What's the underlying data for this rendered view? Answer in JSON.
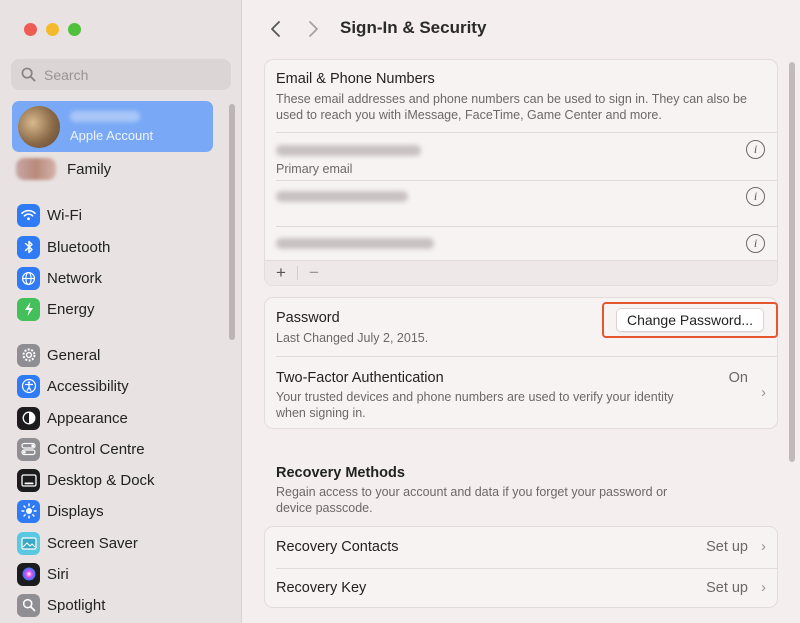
{
  "window": {
    "title": "Sign-In & Security"
  },
  "sidebar": {
    "search_placeholder": "Search",
    "account": {
      "subtitle": "Apple Account"
    },
    "family_label": "Family",
    "items": [
      {
        "label": "Wi-Fi",
        "icon": "wifi-icon",
        "color": "#2f7bf5"
      },
      {
        "label": "Bluetooth",
        "icon": "bluetooth-icon",
        "color": "#2f7bf5"
      },
      {
        "label": "Network",
        "icon": "globe-icon",
        "color": "#2f7bf5"
      },
      {
        "label": "Energy",
        "icon": "energy-icon",
        "color": "#43c05a"
      },
      {
        "label": "General",
        "icon": "gear-icon",
        "color": "#8e8e93"
      },
      {
        "label": "Accessibility",
        "icon": "accessibility-icon",
        "color": "#2f7bf5"
      },
      {
        "label": "Appearance",
        "icon": "appearance-icon",
        "color": "#1c1c1e"
      },
      {
        "label": "Control Centre",
        "icon": "control-centre-icon",
        "color": "#8e8e93"
      },
      {
        "label": "Desktop & Dock",
        "icon": "dock-icon",
        "color": "#1c1c1e"
      },
      {
        "label": "Displays",
        "icon": "displays-icon",
        "color": "#2f7bf5"
      },
      {
        "label": "Screen Saver",
        "icon": "screensaver-icon",
        "color": "#5ac8e0"
      },
      {
        "label": "Siri",
        "icon": "siri-icon",
        "color": "#1c1c1e"
      },
      {
        "label": "Spotlight",
        "icon": "spotlight-icon",
        "color": "#8e8e93"
      }
    ]
  },
  "email_section": {
    "title": "Email & Phone Numbers",
    "description": "These email addresses and phone numbers can be used to sign in. They can also be used to reach you with iMessage, FaceTime, Game Center and more.",
    "primary_label": "Primary email",
    "add_label": "+",
    "remove_label": "−"
  },
  "password_section": {
    "title": "Password",
    "last_changed": "Last Changed July 2, 2015.",
    "change_button": "Change Password...",
    "highlight_color": "#e4572e"
  },
  "two_factor": {
    "title": "Two-Factor Authentication",
    "status": "On",
    "description": "Your trusted devices and phone numbers are used to verify your identity when signing in."
  },
  "recovery": {
    "title": "Recovery Methods",
    "description": "Regain access to your account and data if you forget your password or device passcode.",
    "rows": [
      {
        "label": "Recovery Contacts",
        "status": "Set up"
      },
      {
        "label": "Recovery Key",
        "status": "Set up"
      }
    ]
  }
}
